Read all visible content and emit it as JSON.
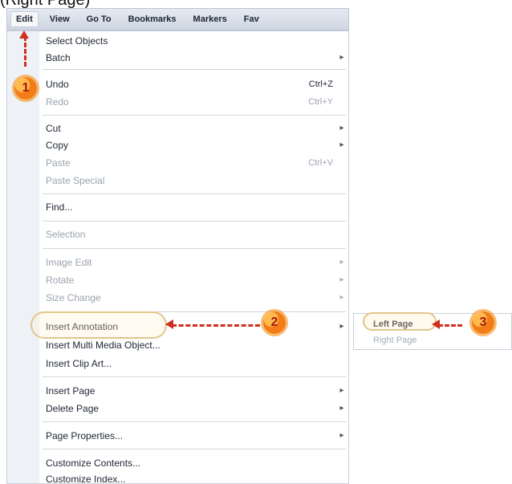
{
  "caption": "(Right Page)",
  "menubar": {
    "items": [
      {
        "label": "Edit",
        "active": true
      },
      {
        "label": "View",
        "active": false
      },
      {
        "label": "Go To",
        "active": false
      },
      {
        "label": "Bookmarks",
        "active": false
      },
      {
        "label": "Markers",
        "active": false
      },
      {
        "label": "Fav"
      }
    ]
  },
  "edit_menu": {
    "items": [
      {
        "label": "Select Objects",
        "shortcut": "",
        "has_submenu": false,
        "disabled": false
      },
      {
        "label": "Batch",
        "shortcut": "",
        "has_submenu": true,
        "disabled": false
      },
      {
        "label": "Undo",
        "shortcut": "Ctrl+Z",
        "has_submenu": false,
        "disabled": false
      },
      {
        "label": "Redo",
        "shortcut": "Ctrl+Y",
        "has_submenu": false,
        "disabled": true
      },
      {
        "label": "Cut",
        "shortcut": "",
        "has_submenu": true,
        "disabled": false
      },
      {
        "label": "Copy",
        "shortcut": "",
        "has_submenu": true,
        "disabled": false
      },
      {
        "label": "Paste",
        "shortcut": "Ctrl+V",
        "has_submenu": false,
        "disabled": true
      },
      {
        "label": "Paste Special",
        "shortcut": "",
        "has_submenu": false,
        "disabled": true
      },
      {
        "label": "Find...",
        "shortcut": "",
        "has_submenu": false,
        "disabled": false
      },
      {
        "label": "Selection",
        "shortcut": "",
        "has_submenu": false,
        "disabled": true
      },
      {
        "label": "Image Edit",
        "shortcut": "",
        "has_submenu": true,
        "disabled": true
      },
      {
        "label": "Rotate",
        "shortcut": "",
        "has_submenu": true,
        "disabled": true
      },
      {
        "label": "Size Change",
        "shortcut": "",
        "has_submenu": true,
        "disabled": true
      },
      {
        "label": "Insert Annotation",
        "shortcut": "",
        "has_submenu": true,
        "disabled": false
      },
      {
        "label": "Insert Multi Media Object...",
        "shortcut": "",
        "has_submenu": false,
        "disabled": false
      },
      {
        "label": "Insert Clip Art...",
        "shortcut": "",
        "has_submenu": false,
        "disabled": false
      },
      {
        "label": "Insert Page",
        "shortcut": "",
        "has_submenu": true,
        "disabled": false
      },
      {
        "label": "Delete Page",
        "shortcut": "",
        "has_submenu": true,
        "disabled": false
      },
      {
        "label": "Page Properties...",
        "shortcut": "",
        "has_submenu": true,
        "disabled": false
      },
      {
        "label": "Customize Contents...",
        "shortcut": "",
        "has_submenu": false,
        "disabled": false
      },
      {
        "label": "Customize Index...",
        "shortcut": "",
        "has_submenu": false,
        "disabled": false
      }
    ]
  },
  "submenu": {
    "items": [
      {
        "label": "Left Page",
        "disabled": false
      },
      {
        "label": "Right Page",
        "disabled": true
      }
    ]
  },
  "annotations": {
    "badge_1": "1",
    "badge_2": "2",
    "badge_3": "3",
    "accent_red": "#cf2f20",
    "accent_orange": "#f27d16"
  }
}
